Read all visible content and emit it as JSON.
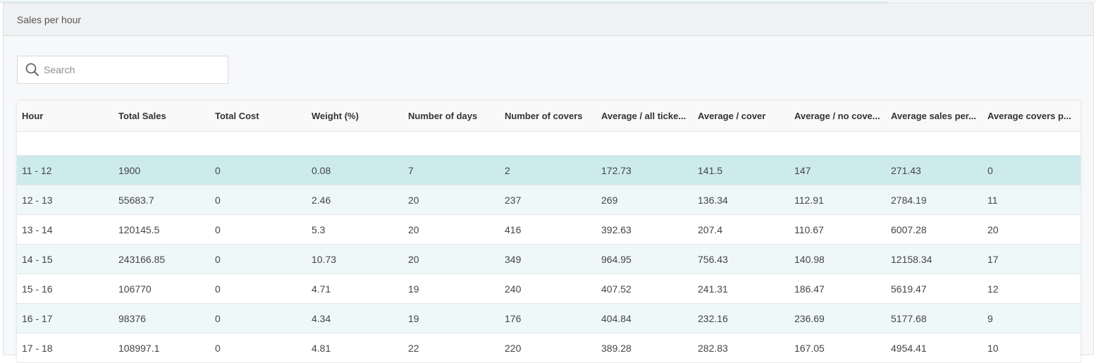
{
  "panel": {
    "title": "Sales per hour"
  },
  "search": {
    "placeholder": "Search",
    "value": ""
  },
  "table": {
    "columns": [
      "Hour",
      "Total Sales",
      "Total Cost",
      "Weight (%)",
      "Number of days",
      "Number of covers",
      "Average / all ticke...",
      "Average / cover",
      "Average / no cove...",
      "Average sales per...",
      "Average covers p..."
    ],
    "rows": [
      [
        "11 - 12",
        "1900",
        "0",
        "0.08",
        "7",
        "2",
        "172.73",
        "141.5",
        "147",
        "271.43",
        "0"
      ],
      [
        "12 - 13",
        "55683.7",
        "0",
        "2.46",
        "20",
        "237",
        "269",
        "136.34",
        "112.91",
        "2784.19",
        "11"
      ],
      [
        "13 - 14",
        "120145.5",
        "0",
        "5.3",
        "20",
        "416",
        "392.63",
        "207.4",
        "110.67",
        "6007.28",
        "20"
      ],
      [
        "14 - 15",
        "243166.85",
        "0",
        "10.73",
        "20",
        "349",
        "964.95",
        "756.43",
        "140.98",
        "12158.34",
        "17"
      ],
      [
        "15 - 16",
        "106770",
        "0",
        "4.71",
        "19",
        "240",
        "407.52",
        "241.31",
        "186.47",
        "5619.47",
        "12"
      ],
      [
        "16 - 17",
        "98376",
        "0",
        "4.34",
        "19",
        "176",
        "404.84",
        "232.16",
        "236.69",
        "5177.68",
        "9"
      ],
      [
        "17 - 18",
        "108997.1",
        "0",
        "4.81",
        "22",
        "220",
        "389.28",
        "282.83",
        "167.05",
        "4954.41",
        "10"
      ]
    ]
  },
  "colors": {
    "selected_row": "#cdebec",
    "striped_row": "#eff8f8"
  }
}
